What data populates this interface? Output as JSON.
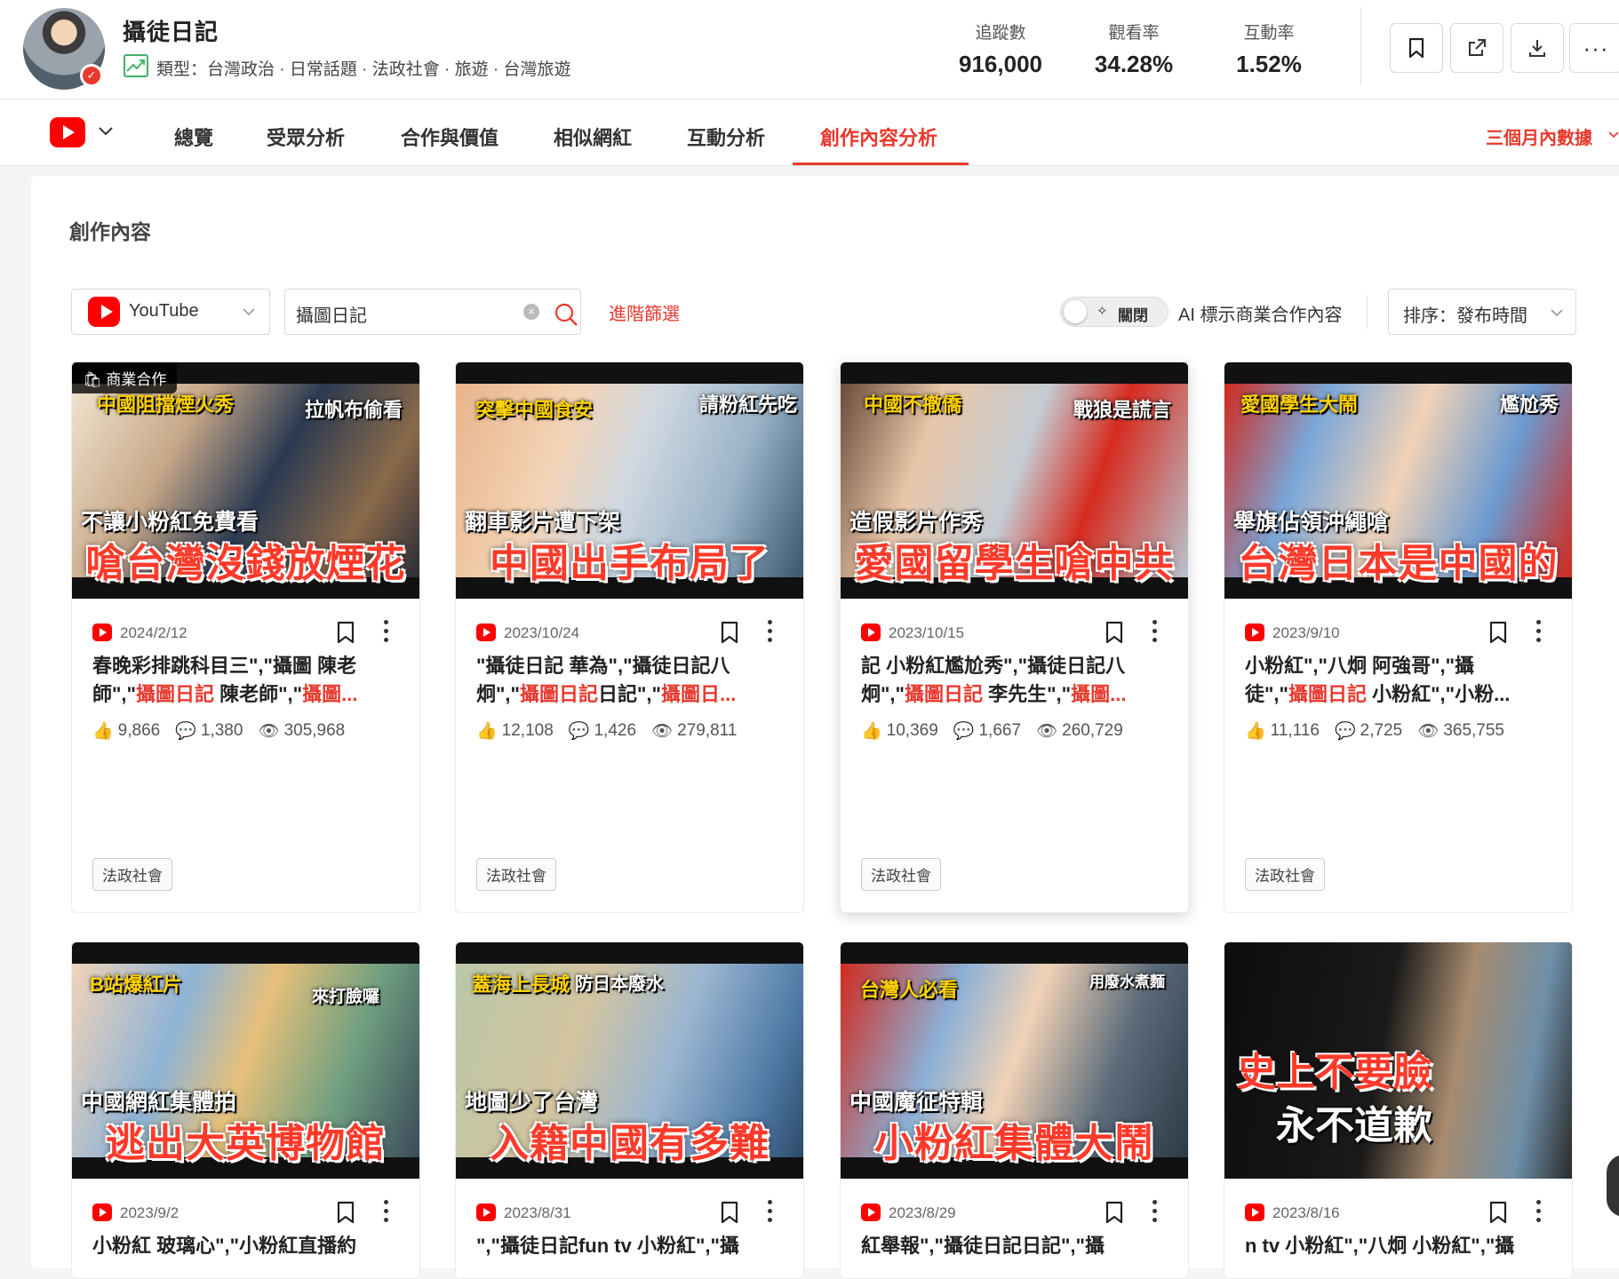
{
  "profile": {
    "name": "攝徒日記",
    "type_line": "類型：台灣政治 · 日常話題 · 法政社會 · 旅遊 · 台灣旅遊",
    "stats": [
      {
        "label": "追蹤數",
        "value": "916,000"
      },
      {
        "label": "觀看率",
        "value": "34.28%"
      },
      {
        "label": "互動率",
        "value": "1.52%"
      }
    ]
  },
  "nav": {
    "tabs": [
      "總覽",
      "受眾分析",
      "合作與價值",
      "相似網紅",
      "互動分析",
      "創作內容分析"
    ],
    "active_tab": "創作內容分析",
    "period": "三個月內數據"
  },
  "content": {
    "section_title": "創作內容",
    "platform_select": "YouTube",
    "search_value": "攝圖日記",
    "advanced_filter": "進階篩選",
    "toggle_label": "關閉",
    "ai_label": "AI 標示商業合作內容",
    "sort_label": "排序：發布時間"
  },
  "colors": {
    "accent": "#e8392d",
    "youtube": "#ff0000"
  },
  "cards": [
    {
      "date": "2024/2/12",
      "biz_badge": "商業合作",
      "thumb_top_left": "中國阻擋煙火秀",
      "thumb_top_right": "拉帆布偷看",
      "thumb_mid": "不讓小粉紅免費看",
      "thumb_big": "嗆台灣沒錢放煙花",
      "t1": "春晚彩排跳科目三\",\"攝圖 陳老",
      "t2a": "師\",\"",
      "t2b": "攝圖日記",
      "t2c": " 陳老師\",\"",
      "t2d": "攝圖...",
      "likes": "9,866",
      "comments": "1,380",
      "views": "305,968",
      "tag": "法政社會"
    },
    {
      "date": "2023/10/24",
      "biz_badge": "",
      "thumb_top_left": "突擊中國食安",
      "thumb_top_right": "請粉紅先吃",
      "thumb_mid": "翻車影片遭下架",
      "thumb_big": "中國出手布局了",
      "t1": "\"攝徒日記 華為\",\"攝徒日記八",
      "t2a": "炯\",\"",
      "t2b": "攝圖日記",
      "t2c": "日記\",\"",
      "t2d": "攝圖日...",
      "likes": "12,108",
      "comments": "1,426",
      "views": "279,811",
      "tag": "法政社會"
    },
    {
      "date": "2023/10/15",
      "biz_badge": "",
      "thumb_top_left": "中國不撤僑",
      "thumb_top_right": "戰狼是謊言",
      "thumb_mid": "造假影片作秀",
      "thumb_big": "愛國留學生嗆中共",
      "t1": "記 小粉紅尷尬秀\",\"攝徒日記八",
      "t2a": "炯\",\"",
      "t2b": "攝圖日記",
      "t2c": " 李先生\",\"",
      "t2d": "攝圖...",
      "likes": "10,369",
      "comments": "1,667",
      "views": "260,729",
      "tag": "法政社會"
    },
    {
      "date": "2023/9/10",
      "biz_badge": "",
      "thumb_top_left": "愛國學生大鬧",
      "thumb_top_right": "尷尬秀",
      "thumb_mid": "舉旗佔領沖繩嗆",
      "thumb_big": "台灣日本是中國的",
      "t1": "小粉紅\",\"八炯 阿強哥\",\"攝",
      "t2a": "徒\",\"",
      "t2b": "攝圖日記",
      "t2c": " 小粉紅\",\"小粉...",
      "t2d": "",
      "likes": "11,116",
      "comments": "2,725",
      "views": "365,755",
      "tag": "法政社會"
    },
    {
      "date": "2023/9/2",
      "biz_badge": "",
      "thumb_top_left": "B站爆紅片",
      "thumb_top_right": "來打臉囉",
      "thumb_mid": "中國網紅集體拍",
      "thumb_big": "逃出大英博物館",
      "t1": "小粉紅 玻璃心\",\"小粉紅直播約",
      "t2a": "",
      "t2b": "",
      "t2c": "",
      "t2d": "",
      "likes": "",
      "comments": "",
      "views": "",
      "tag": ""
    },
    {
      "date": "2023/8/31",
      "biz_badge": "",
      "thumb_top_left": "蓋海上長城",
      "thumb_top_right": "防日本廢水",
      "thumb_mid": "地圖少了台灣",
      "thumb_big": "入籍中國有多難",
      "t1": "\",\"攝徒日記fun tv 小粉紅\",\"攝",
      "t2a": "",
      "t2b": "",
      "t2c": "",
      "t2d": "",
      "likes": "",
      "comments": "",
      "views": "",
      "tag": ""
    },
    {
      "date": "2023/8/29",
      "biz_badge": "",
      "thumb_top_left": "台灣人必看",
      "thumb_top_right": "用廢水煮麵",
      "thumb_mid": "中國魔征特輯",
      "thumb_big": "小粉紅集體大鬧",
      "t1": "紅舉報\",\"攝徒日記日記\",\"攝",
      "t2a": "",
      "t2b": "",
      "t2c": "",
      "t2d": "",
      "likes": "",
      "comments": "",
      "views": "",
      "tag": ""
    },
    {
      "date": "2023/8/16",
      "biz_badge": "",
      "thumb_top_left": "",
      "thumb_top_right": "",
      "thumb_mid": "史上不要臉",
      "thumb_big": "永不道歉",
      "t1": "n tv 小粉紅\",\"八炯 小粉紅\",\"攝",
      "t2a": "",
      "t2b": "",
      "t2c": "",
      "t2d": "",
      "likes": "",
      "comments": "",
      "views": "",
      "tag": ""
    }
  ]
}
